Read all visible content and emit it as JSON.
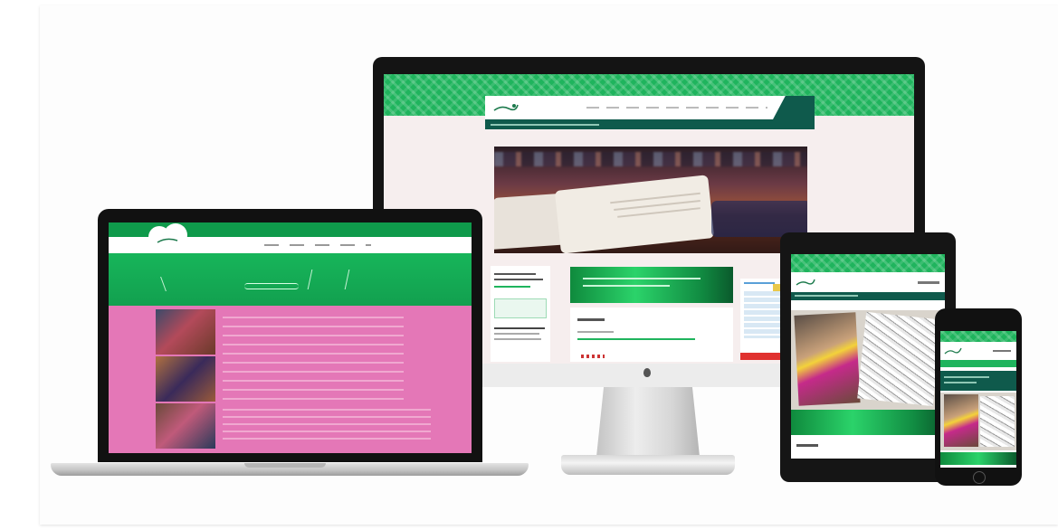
{
  "colors": {
    "brand_green": "#1fb45d",
    "dark_teal": "#0f5a4c",
    "accent_pink": "#e477b7",
    "red_bar": "#e0312f"
  },
  "icons": [
    "apple-logo-icon",
    "bird-logo-icon",
    "clover-logo-icon",
    "calendar-icon"
  ],
  "monitor_site": {
    "nav": [
      "",
      "",
      "",
      "",
      "",
      "",
      ""
    ],
    "banner_text": "",
    "content_heading": "",
    "content_text": "",
    "green_box_text": ""
  },
  "laptop_site": {
    "header_script": "",
    "nav": [
      "",
      "",
      "",
      "",
      ""
    ]
  },
  "tablet_site": {
    "section_label": ""
  },
  "phone_site": {
    "section_label": ""
  }
}
